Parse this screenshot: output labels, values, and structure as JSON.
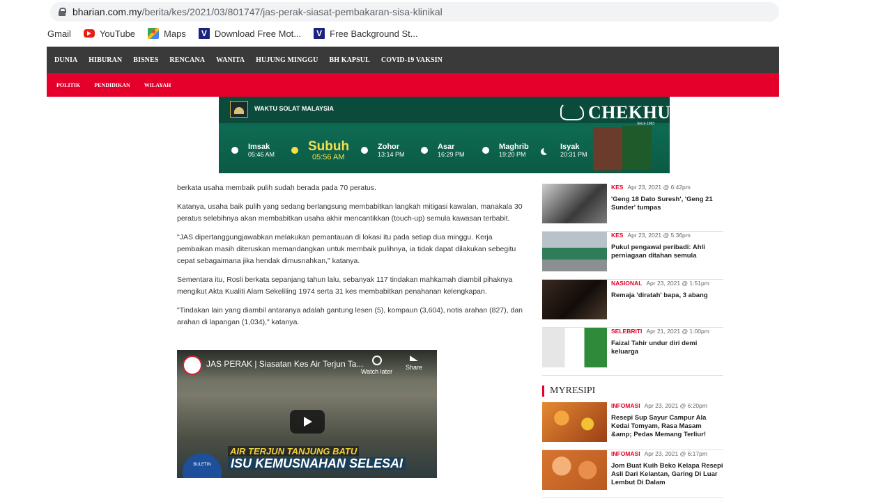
{
  "browser": {
    "url_host": "bharian.com.my",
    "url_path": "/berita/kes/2021/03/801747/jas-perak-siasat-pembakaran-sisa-klinikal",
    "bookmarks": [
      {
        "label": "Gmail",
        "icon": "gmail-icon"
      },
      {
        "label": "YouTube",
        "icon": "youtube-icon"
      },
      {
        "label": "Maps",
        "icon": "maps-icon"
      },
      {
        "label": "Download Free Mot...",
        "icon": "v-logo-icon"
      },
      {
        "label": "Free Background St...",
        "icon": "v-logo-icon"
      }
    ]
  },
  "nav": {
    "main": [
      "DUNIA",
      "HIBURAN",
      "BISNES",
      "RENCANA",
      "WANITA",
      "HUJUNG MINGGU",
      "BH KAPSUL",
      "COVID-19 VAKSIN"
    ],
    "sub": [
      "POLITIK",
      "PENDIDIKAN",
      "WILAYAH"
    ],
    "accent": "#e4002b"
  },
  "banner": {
    "title": "WAKTU SOLAT MALAYSIA",
    "brand": "CHEKHUP",
    "since": "Since 1983",
    "prayers": [
      {
        "name": "Imsak",
        "time": "05:46 AM"
      },
      {
        "name": "Subuh",
        "time": "05:56 AM"
      },
      {
        "name": "Zohor",
        "time": "13:14 PM"
      },
      {
        "name": "Asar",
        "time": "16:29 PM"
      },
      {
        "name": "Maghrib",
        "time": "19:20 PM"
      },
      {
        "name": "Isyak",
        "time": "20:31 PM"
      }
    ]
  },
  "article": {
    "paragraphs": [
      "berkata usaha membaik pulih sudah berada pada 70 peratus.",
      "Katanya, usaha baik pulih yang sedang berlangsung membabitkan langkah mitigasi kawalan, manakala 30 peratus selebihnya akan membabitkan usaha akhir mencantikkan (touch-up) semula kawasan terbabit.",
      "\"JAS dipertanggungjawabkan melakukan pemantauan di lokasi itu pada setiap dua minggu. Kerja pembaikan masih diteruskan memandangkan untuk membaik pulihnya, ia tidak dapat dilakukan sebegitu cepat sebagaimana jika hendak dimusnahkan,\" katanya.",
      "Sementara itu, Rosli berkata sepanjang tahun lalu, sebanyak 117 tindakan mahkamah diambil pihaknya mengikut Akta Kualiti Alam Sekeliling 1974 serta 31 kes membabitkan penahanan kelengkapan.",
      "\"Tindakan lain yang diambil antaranya adalah gantung lesen (5), kompaun (3,604), notis arahan (827), dan arahan di lapangan (1,034),\" katanya."
    ],
    "video": {
      "title": "JAS PERAK | Siasatan Kes Air Terjun Ta...",
      "watch_later": "Watch later",
      "share": "Share",
      "caption_top": "AIR TERJUN TANJUNG BATU",
      "caption_main": "ISU KEMUSNAHAN SELESAI",
      "logo_text": "BULETIN"
    }
  },
  "sidebar": {
    "news": [
      {
        "cat": "KES",
        "date": "Apr 23, 2021 @ 6:42pm",
        "headline": "'Geng 18 Dato Suresh', 'Geng 21 Sunder' tumpas",
        "thumb": "t1"
      },
      {
        "cat": "KES",
        "date": "Apr 23, 2021 @ 5:36pm",
        "headline": "Pukul pengawal peribadi: Ahli perniagaan ditahan semula",
        "thumb": "t2"
      },
      {
        "cat": "NASIONAL",
        "date": "Apr 23, 2021 @ 1:51pm",
        "headline": "Remaja 'diratah' bapa, 3 abang",
        "thumb": "t3"
      },
      {
        "cat": "SELEBRITI",
        "date": "Apr 21, 2021 @ 1:00pm",
        "headline": "Faizal Tahir undur diri demi keluarga",
        "thumb": "t4"
      }
    ],
    "resipi_title": "MYRESIPI",
    "resipi": [
      {
        "cat": "INFOMASI",
        "date": "Apr 23, 2021 @ 6:20pm",
        "headline": "Resepi Sup Sayur Campur Ala Kedai Tomyam, Rasa Masam &amp; Pedas Memang Terliur!",
        "thumb": "t5"
      },
      {
        "cat": "INFOMASI",
        "date": "Apr 23, 2021 @ 6:17pm",
        "headline": "Jom Buat Kuih Beko Kelapa Resepi Asli Dari Kelantan, Garing Di Luar Lembut Di Dalam",
        "thumb": "t6"
      }
    ]
  }
}
